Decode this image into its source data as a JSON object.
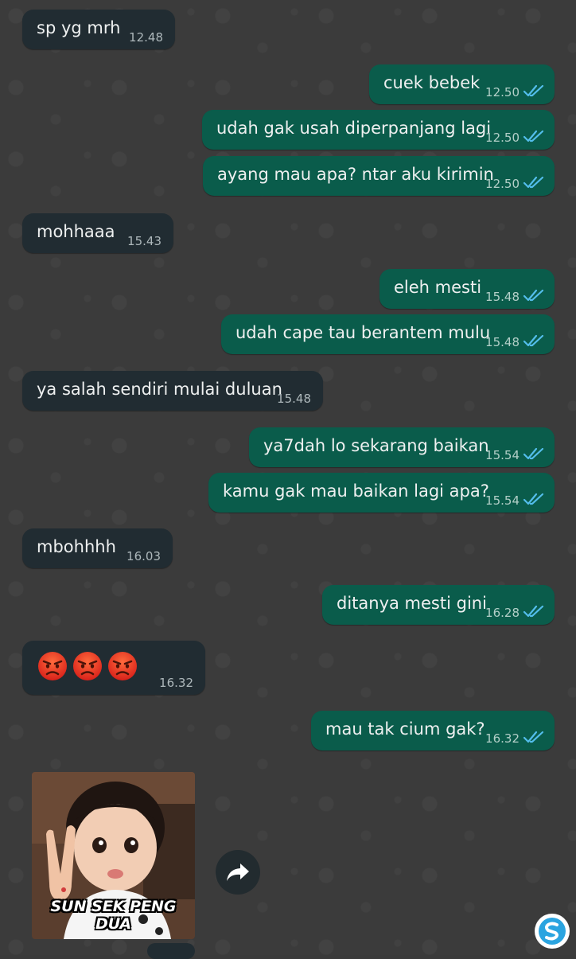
{
  "colors": {
    "incoming_bubble": "#212c32",
    "outgoing_bubble": "#0a5c4b",
    "read_ticks": "#53bdeb"
  },
  "messages": [
    {
      "direction": "in",
      "text": "sp yg mrh",
      "time": "12.48"
    },
    {
      "direction": "out",
      "text": "cuek bebek",
      "time": "12.50",
      "status": "read"
    },
    {
      "direction": "out",
      "text": "udah gak usah diperpanjang lagi",
      "time": "12.50",
      "status": "read"
    },
    {
      "direction": "out",
      "text": "ayang mau apa? ntar aku kirimin",
      "time": "12.50",
      "status": "read"
    },
    {
      "direction": "in",
      "text": "mohhaaa",
      "time": "15.43"
    },
    {
      "direction": "out",
      "text": "eleh mesti",
      "time": "15.48",
      "status": "read"
    },
    {
      "direction": "out",
      "text": "udah cape tau berantem mulu",
      "time": "15.48",
      "status": "read"
    },
    {
      "direction": "in",
      "text": "ya salah sendiri mulai duluan",
      "time": "15.48"
    },
    {
      "direction": "out",
      "text": "ya7dah lo sekarang baikan",
      "time": "15.54",
      "status": "read"
    },
    {
      "direction": "out",
      "text": "kamu gak mau baikan lagi apa?",
      "time": "15.54",
      "status": "read"
    },
    {
      "direction": "in",
      "text": "mbohhhh",
      "time": "16.03"
    },
    {
      "direction": "out",
      "text": "ditanya mesti gini",
      "time": "16.28",
      "status": "read"
    },
    {
      "direction": "in",
      "emoji": [
        "angry-face-icon",
        "angry-face-icon",
        "angry-face-icon"
      ],
      "time": "16.32"
    },
    {
      "direction": "out",
      "text": "mau tak cium gak?",
      "time": "16.32",
      "status": "read"
    }
  ],
  "sticker": {
    "direction": "in",
    "caption": "SUN SEK PENG DUA",
    "forward_icon": "forward-arrow-icon"
  },
  "watermark_icon": "s-logo-icon"
}
